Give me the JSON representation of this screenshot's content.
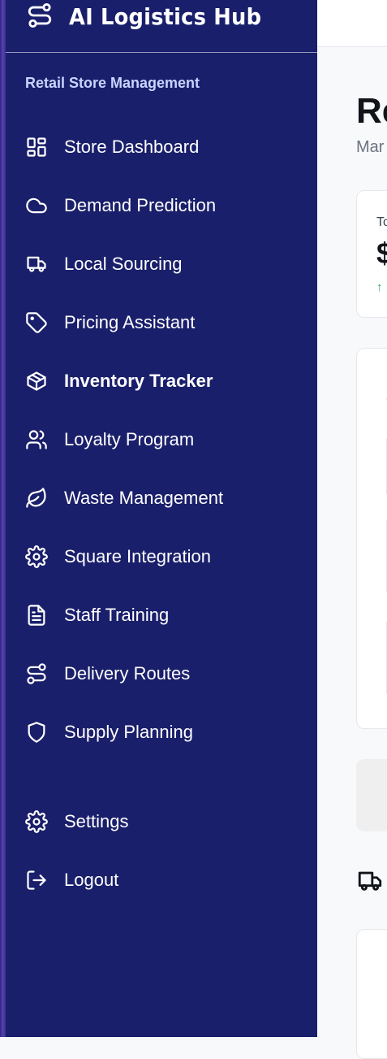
{
  "app": {
    "title": "AI Logistics Hub",
    "section_label": "Retail Store Management"
  },
  "sidebar": {
    "items": [
      {
        "label": "Store Dashboard",
        "icon": "dashboard-icon"
      },
      {
        "label": "Demand Prediction",
        "icon": "cloud-icon"
      },
      {
        "label": "Local Sourcing",
        "icon": "truck-icon"
      },
      {
        "label": "Pricing Assistant",
        "icon": "tag-icon"
      },
      {
        "label": "Inventory Tracker",
        "icon": "package-icon",
        "active": true
      },
      {
        "label": "Loyalty Program",
        "icon": "users-icon"
      },
      {
        "label": "Waste Management",
        "icon": "leaf-icon"
      },
      {
        "label": "Square Integration",
        "icon": "gear-icon"
      },
      {
        "label": "Staff Training",
        "icon": "document-icon"
      },
      {
        "label": "Delivery Routes",
        "icon": "route-icon"
      },
      {
        "label": "Supply Planning",
        "icon": "shield-icon"
      }
    ],
    "footer": [
      {
        "label": "Settings",
        "icon": "gear-icon"
      },
      {
        "label": "Logout",
        "icon": "logout-icon"
      }
    ]
  },
  "main": {
    "title_partial": "Re",
    "subtitle_partial": "Mar",
    "stat_card": {
      "label_partial": "To",
      "value_partial": "$",
      "trend_partial": "↑"
    }
  },
  "colors": {
    "sidebar_bg": "#1a1f6b",
    "section_label": "#c9d4ff",
    "trend_up": "#16a34a"
  }
}
